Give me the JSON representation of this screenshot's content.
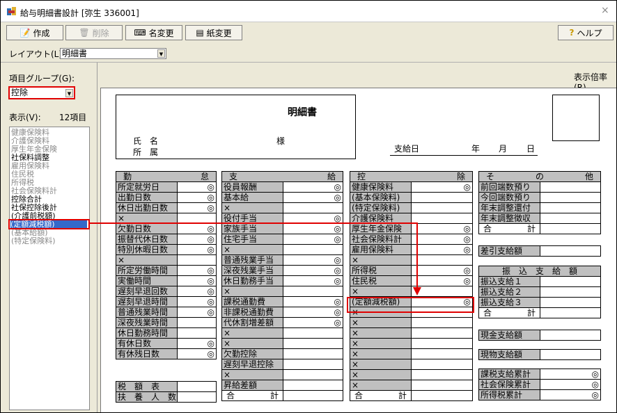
{
  "window": {
    "title": "給与明細書設計 [弥生 336001]",
    "close_glyph": "×"
  },
  "toolbar": {
    "create": "作成",
    "delete": "削除",
    "rename": "名変更",
    "paper": "紙変更",
    "help": "ヘルプ"
  },
  "layout": {
    "label": "レイアウト(L):",
    "value": "明細書"
  },
  "left": {
    "group_label": "項目グループ(G):",
    "group_value": "控除",
    "display_label": "表示(V):",
    "count": "12項目",
    "items": [
      {
        "text": "健康保険料",
        "dark": false
      },
      {
        "text": "介護保険料",
        "dark": false
      },
      {
        "text": "厚生年金保険",
        "dark": false
      },
      {
        "text": "社保料調整",
        "dark": true
      },
      {
        "text": "雇用保険料",
        "dark": false
      },
      {
        "text": "住民税",
        "dark": false
      },
      {
        "text": "所得税",
        "dark": false
      },
      {
        "text": "社会保険料計",
        "dark": false
      },
      {
        "text": "控除合計",
        "dark": true
      },
      {
        "text": "社保控除後計",
        "dark": true
      },
      {
        "text": "(介護前税額)",
        "dark": true
      },
      {
        "text": "(定額減税額)",
        "dark": false,
        "selected": true
      },
      {
        "text": "(基本給額)",
        "dark": false
      },
      {
        "text": "(特定保険料)",
        "dark": false
      }
    ]
  },
  "right": {
    "zoom_label": "表示倍率(R)"
  },
  "slip": {
    "title": "明細書",
    "name_label": "氏　名",
    "dept_label": "所　属",
    "honorific": "様",
    "pay_date": "支給日",
    "year": "年",
    "month": "月",
    "day": "日"
  },
  "icons": {
    "circle": "◎",
    "x": "×"
  },
  "attendance": {
    "header": [
      "勤",
      "怠"
    ],
    "rows": [
      {
        "label": "所定就労日",
        "mark": "◎"
      },
      {
        "label": "出勤日数",
        "mark": "◎"
      },
      {
        "label": "休日出勤日数",
        "mark": "◎"
      },
      {
        "label": "×",
        "mark": ""
      },
      {
        "label": "欠勤日数",
        "mark": "◎"
      },
      {
        "label": "振替代休日数",
        "mark": "◎"
      },
      {
        "label": "特別休暇日数",
        "mark": "◎"
      },
      {
        "label": "×",
        "mark": ""
      },
      {
        "label": "所定労働時間",
        "mark": "◎"
      },
      {
        "label": "実働時間",
        "mark": "◎"
      },
      {
        "label": "遅刻早退回数",
        "mark": "◎"
      },
      {
        "label": "遅刻早退時間",
        "mark": "◎"
      },
      {
        "label": "普通残業時間",
        "mark": "◎"
      },
      {
        "label": "深夜残業時間",
        "mark": ""
      },
      {
        "label": "休日勤務時間",
        "mark": ""
      },
      {
        "label": "有休日数",
        "mark": "◎"
      },
      {
        "label": "有休残日数",
        "mark": "◎"
      }
    ],
    "tax": [
      {
        "label": "税　額　表"
      },
      {
        "label": "扶　養　人　数"
      }
    ]
  },
  "payment": {
    "header": [
      "支",
      "給"
    ],
    "rows": [
      {
        "label": "役員報酬",
        "mark": "◎"
      },
      {
        "label": "基本給",
        "mark": "◎"
      },
      {
        "label": "×",
        "mark": ""
      },
      {
        "label": "役付手当",
        "mark": "◎"
      },
      {
        "label": "家族手当",
        "mark": "◎"
      },
      {
        "label": "住宅手当",
        "mark": "◎"
      },
      {
        "label": "×",
        "mark": ""
      },
      {
        "label": "普通残業手当",
        "mark": "◎"
      },
      {
        "label": "深夜残業手当",
        "mark": "◎"
      },
      {
        "label": "休日勤務手当",
        "mark": "◎"
      },
      {
        "label": "×",
        "mark": ""
      },
      {
        "label": "課税通勤費",
        "mark": "◎"
      },
      {
        "label": "非課税通勤費",
        "mark": "◎"
      },
      {
        "label": "代休割増差額",
        "mark": "◎"
      },
      {
        "label": "×",
        "mark": ""
      },
      {
        "label": "×",
        "mark": ""
      },
      {
        "label": "欠勤控除",
        "mark": ""
      },
      {
        "label": "遅刻早退控除",
        "mark": ""
      },
      {
        "label": "×",
        "mark": ""
      },
      {
        "label": "昇給差額",
        "mark": ""
      }
    ],
    "total": [
      "合",
      "計"
    ]
  },
  "deduction": {
    "header": [
      "控",
      "除"
    ],
    "rows": [
      {
        "label": "健康保険料",
        "mark": "◎"
      },
      {
        "label": "(基本保険料)",
        "mark": ""
      },
      {
        "label": "(特定保険料)",
        "mark": ""
      },
      {
        "label": "介護保険料",
        "mark": ""
      },
      {
        "label": "厚生年金保険",
        "mark": "◎"
      },
      {
        "label": "社会保険料計",
        "mark": "◎"
      },
      {
        "label": "雇用保険料",
        "mark": "◎"
      },
      {
        "label": "×",
        "mark": ""
      },
      {
        "label": "所得税",
        "mark": "◎"
      },
      {
        "label": "住民税",
        "mark": "◎"
      },
      {
        "label": "×",
        "mark": ""
      },
      {
        "label": "(定額減税額)",
        "mark": "◎"
      },
      {
        "label": "×",
        "mark": ""
      },
      {
        "label": "×",
        "mark": ""
      },
      {
        "label": "×",
        "mark": ""
      },
      {
        "label": "×",
        "mark": ""
      },
      {
        "label": "×",
        "mark": ""
      },
      {
        "label": "×",
        "mark": ""
      },
      {
        "label": "×",
        "mark": ""
      },
      {
        "label": "×",
        "mark": ""
      }
    ],
    "total": [
      "合",
      "計"
    ]
  },
  "other": {
    "header": [
      "そ",
      "の",
      "他"
    ],
    "rows": [
      {
        "label": "前回端数預り"
      },
      {
        "label": "今回端数預り"
      },
      {
        "label": "年末調整還付"
      },
      {
        "label": "年末調整徴収"
      }
    ],
    "total": [
      "合",
      "計"
    ],
    "net": "差引支給額",
    "transfer_header": "振　込　支　給　額",
    "transfers": [
      {
        "label": "振込支給１"
      },
      {
        "label": "振込支給２"
      },
      {
        "label": "振込支給３"
      }
    ],
    "transfer_total": [
      "合",
      "計"
    ],
    "cash": "現金支給額",
    "goods": "現物支給額",
    "cumulative": [
      {
        "label": "課税支給累計",
        "mark": "◎"
      },
      {
        "label": "社会保険累計",
        "mark": "◎"
      },
      {
        "label": "所得税累計",
        "mark": "◎"
      }
    ]
  },
  "colors": {
    "highlight": "#e00000",
    "selection": "#3569c9",
    "cell_gray": "#c0c0c0"
  }
}
